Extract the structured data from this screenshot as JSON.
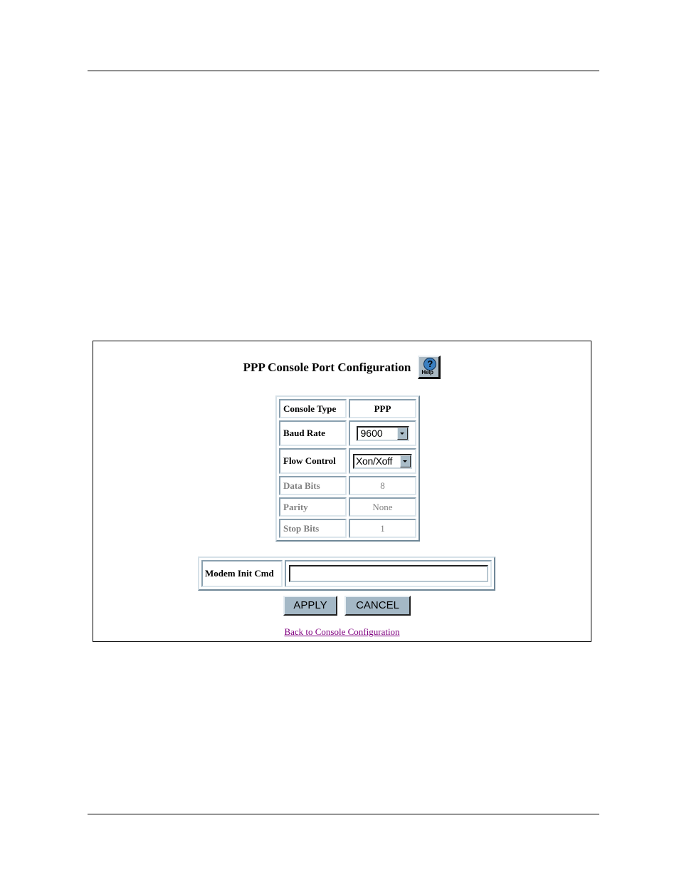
{
  "page": {
    "title": "PPP Console Port Configuration",
    "help_button": {
      "icon": "help-question-icon",
      "label": "Help"
    }
  },
  "config_table": {
    "rows": [
      {
        "label": "Console Type",
        "value": "PPP",
        "type": "static",
        "enabled": true
      },
      {
        "label": "Baud Rate",
        "value": "9600",
        "type": "select",
        "enabled": true
      },
      {
        "label": "Flow Control",
        "value": "Xon/Xoff",
        "type": "select",
        "enabled": true
      },
      {
        "label": "Data Bits",
        "value": "8",
        "type": "static",
        "enabled": false
      },
      {
        "label": "Parity",
        "value": "None",
        "type": "static",
        "enabled": false
      },
      {
        "label": "Stop Bits",
        "value": "1",
        "type": "static",
        "enabled": false
      }
    ]
  },
  "modem": {
    "label": "Modem Init Cmd",
    "value": "",
    "placeholder": ""
  },
  "actions": {
    "apply_label": "APPLY",
    "cancel_label": "CANCEL"
  },
  "links": {
    "back_label": "Back to Console Configuration"
  },
  "colors": {
    "button_face": "#a4b8c6",
    "link_visited": "#800080",
    "disabled_text": "#808080"
  }
}
